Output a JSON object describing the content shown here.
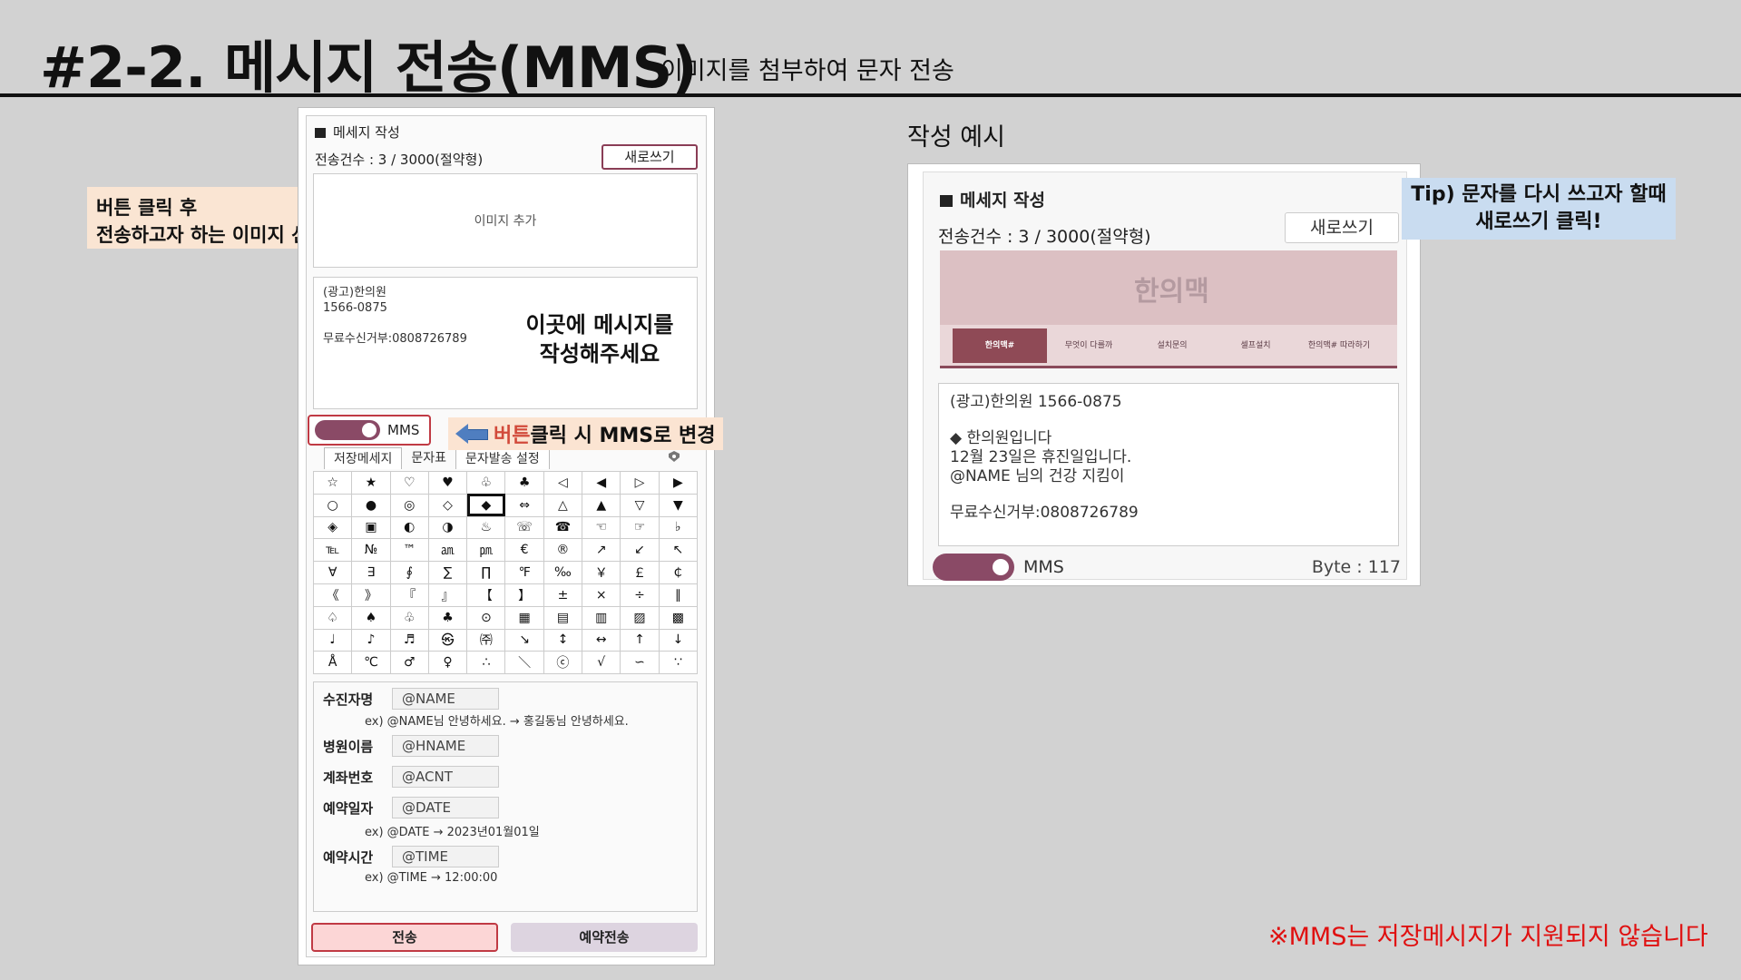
{
  "slide": {
    "title": "#2-2. 메시지 전송(MMS)",
    "subtitle": "이미지를 첨부하여 문자 전송",
    "example_heading": "작성 예시",
    "warning": "※MMS는 저장메시지가 지원되지 않습니다"
  },
  "callouts": {
    "select_line1": "버튼 클릭 후",
    "select_line2": "전송하고자 하는 이미지 선택",
    "write_line1": "이곳에 메시지를",
    "write_line2": "작성해주세요",
    "mms_red": "버튼",
    "mms_rest": "클릭 시 MMS로 변경",
    "tip_line1": "Tip) 문자를 다시 쓰고자 할때",
    "tip_line2": "새로쓰기 클릭!"
  },
  "form": {
    "title": "메세지 작성",
    "count": "전송건수 : 3 / 3000(절약형)",
    "new_button": "새로쓰기",
    "image_add": "이미지 추가",
    "message": {
      "line1": "(광고)한의원",
      "line2": "1566-0875",
      "line3": "무료수신거부:0808726789"
    },
    "toggle_label": "MMS",
    "tabs": [
      "저장메세지",
      "문자표",
      "문자발송 설정"
    ],
    "symbols": [
      [
        "☆",
        "★",
        "♡",
        "♥",
        "♧",
        "♣",
        "◁",
        "◀",
        "▷",
        "▶"
      ],
      [
        "○",
        "●",
        "◎",
        "◇",
        "◆",
        "⇔",
        "△",
        "▲",
        "▽",
        "▼"
      ],
      [
        "◈",
        "▣",
        "◐",
        "◑",
        "♨",
        "☏",
        "☎",
        "☜",
        "☞",
        "♭"
      ],
      [
        "℡",
        "№",
        "™",
        "㏂",
        "㏘",
        "€",
        "®",
        "↗",
        "↙",
        "↖"
      ],
      [
        "∀",
        "∃",
        "∮",
        "∑",
        "∏",
        "℉",
        "‰",
        "￥",
        "￡",
        "￠"
      ],
      [
        "《",
        "》",
        "『",
        "』",
        "【",
        "】",
        "±",
        "×",
        "÷",
        "∥"
      ],
      [
        "♤",
        "♠",
        "♧",
        "♣",
        "⊙",
        "▦",
        "▤",
        "▥",
        "▨",
        "▩"
      ],
      [
        "♩",
        "♪",
        "♬",
        "㉿",
        "㈜",
        "↘",
        "↕",
        "↔",
        "↑",
        "↓"
      ],
      [
        "Å",
        "℃",
        "♂",
        "♀",
        "∴",
        "＼",
        "ⓒ",
        "√",
        "∽",
        "∵"
      ]
    ],
    "variables": [
      {
        "label": "수진자명",
        "value": "@NAME"
      },
      {
        "label": "병원이름",
        "value": "@HNAME"
      },
      {
        "label": "계좌번호",
        "value": "@ACNT"
      },
      {
        "label": "예약일자",
        "value": "@DATE"
      },
      {
        "label": "예약시간",
        "value": "@TIME"
      }
    ],
    "examples": {
      "name": "ex) @NAME님 안녕하세요. → 홍길동님 안녕하세요.",
      "date": "ex) @DATE → 2023년01월01일",
      "time": "ex) @TIME → 12:00:00"
    },
    "send_button": "전송",
    "reserve_button": "예약전송"
  },
  "example": {
    "title": "메세지 작성",
    "count": "전송건수 : 3 / 3000(절약형)",
    "new_button": "새로쓰기",
    "logo": "한의맥",
    "nav": [
      "한의맥#",
      "무엇이 다를까",
      "설치문의",
      "셀프설치",
      "한의맥# 따라하기"
    ],
    "message": {
      "line1": "(광고)한의원 1566-0875",
      "line2": "◆ 한의원입니다",
      "line3": "12월 23일은 휴진일입니다.",
      "line4": "@NAME 님의 건강 지킴이",
      "line5": "무료수신거부:0808726789"
    },
    "toggle_label": "MMS",
    "byte": "Byte : 117"
  },
  "colors": {
    "accent_toggle": "#8a4a66",
    "send_bg": "#fcd6d6",
    "reserve_bg": "#ddd4e0",
    "warning": "#e01010"
  }
}
